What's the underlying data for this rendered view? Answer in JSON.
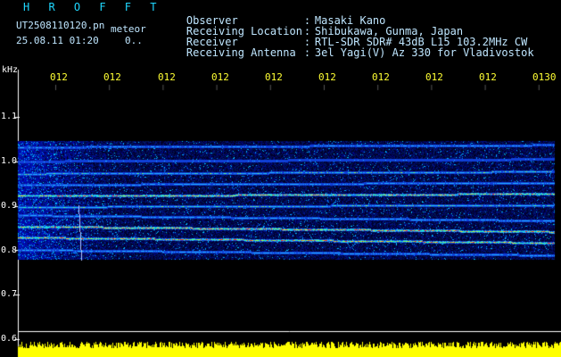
{
  "header": {
    "brand": "H R O F F T",
    "filename": "UT2508110120.pn",
    "mode_tag": "meteor",
    "datetime": "25.08.11 01:20",
    "truncated": "0.."
  },
  "meta": [
    {
      "key": "Observer",
      "value": "Masaki Kano"
    },
    {
      "key": "Receiving Location",
      "value": "Shibukawa, Gunma, Japan"
    },
    {
      "key": "Receiver",
      "value": "RTL-SDR SDR# 43dB L15 103.2MHz CW"
    },
    {
      "key": "Receiving Antenna",
      "value": "3el Yagi(V) Az 330 for Vladivostok"
    }
  ],
  "y_axis": {
    "unit": "kHz",
    "ticks": [
      {
        "label": "1.1",
        "value": 1.1
      },
      {
        "label": "1.0",
        "value": 1.0
      },
      {
        "label": "0.9",
        "value": 0.9
      },
      {
        "label": "0.8",
        "value": 0.8
      },
      {
        "label": "0.7",
        "value": 0.7
      },
      {
        "label": "0.6",
        "value": 0.6
      }
    ],
    "range": [
      0.6,
      1.2
    ]
  },
  "time_axis": {
    "labels": [
      "012",
      "012",
      "012",
      "012",
      "012",
      "012",
      "012",
      "012",
      "012",
      "0130"
    ]
  },
  "colors": {
    "background": "#000000",
    "text": "#bfe6ff",
    "brand": "#1fd8ff",
    "time_labels": "#ffff33",
    "signal_bar": "#ffff00",
    "band_bg": "#000a64"
  },
  "signals": [
    {
      "freq_khz": 1.035,
      "intensity": 0.45
    },
    {
      "freq_khz": 1.003,
      "intensity": 0.35
    },
    {
      "freq_khz": 0.975,
      "intensity": 0.55
    },
    {
      "freq_khz": 0.95,
      "intensity": 0.5
    },
    {
      "freq_khz": 0.925,
      "intensity": 0.85
    },
    {
      "freq_khz": 0.9,
      "intensity": 0.55
    },
    {
      "freq_khz": 0.873,
      "intensity": 0.5
    },
    {
      "freq_khz": 0.848,
      "intensity": 0.9
    },
    {
      "freq_khz": 0.823,
      "intensity": 0.85
    },
    {
      "freq_khz": 0.795,
      "intensity": 0.5
    }
  ],
  "noise_band_khz": [
    0.78,
    1.045
  ]
}
